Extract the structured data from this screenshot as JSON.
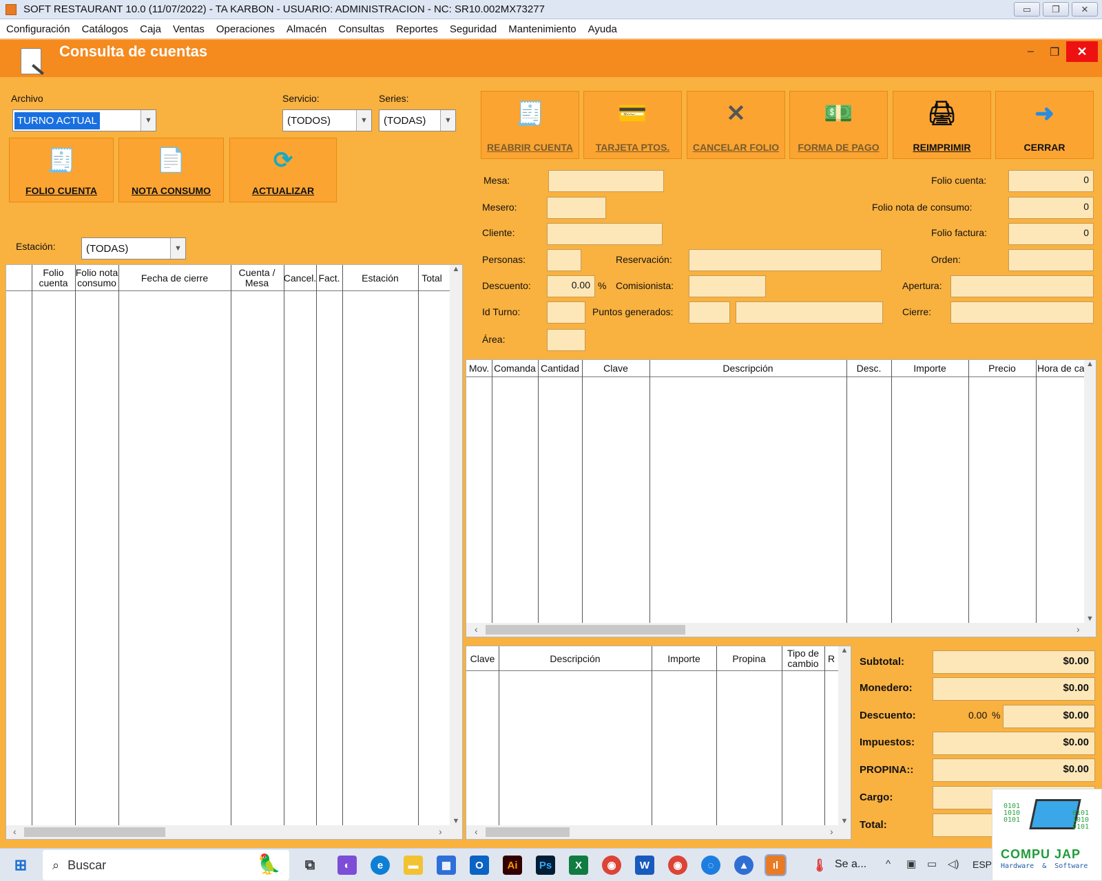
{
  "window": {
    "title": "SOFT RESTAURANT  10.0 (11/07/2022)  -  TA KARBON  -  USUARIO: ADMINISTRACION    -   NC: SR10.002MX73277"
  },
  "menu": [
    "Configuración",
    "Catálogos",
    "Caja",
    "Ventas",
    "Operaciones",
    "Almacén",
    "Consultas",
    "Reportes",
    "Seguridad",
    "Mantenimiento",
    "Ayuda"
  ],
  "header": {
    "title": "Consulta de cuentas"
  },
  "filters": {
    "archivo_label": "Archivo",
    "archivo_value": "TURNO ACTUAL",
    "servicio_label": "Servicio:",
    "servicio_value": "(TODOS)",
    "series_label": "Series:",
    "series_value": "(TODAS)",
    "estacion_label": "Estación:",
    "estacion_value": "(TODAS)"
  },
  "left_buttons": [
    "FOLIO CUENTA",
    "NOTA CONSUMO",
    "ACTUALIZAR"
  ],
  "actions": [
    "REABRIR CUENTA",
    "TARJETA PTOS.",
    "CANCELAR FOLIO",
    "FORMA DE PAGO",
    "REIMPRIMIR",
    "CERRAR"
  ],
  "form": {
    "mesa": "Mesa:",
    "mesero": "Mesero:",
    "cliente": "Cliente:",
    "personas": "Personas:",
    "reservacion": "Reservación:",
    "descuento": "Descuento:",
    "descuento_value": "0.00",
    "pct": "%",
    "comisionista": "Comisionista:",
    "id_turno": "Id Turno:",
    "puntos": "Puntos generados:",
    "area": "Área:",
    "folio_cuenta": "Folio cuenta:",
    "folio_cuenta_value": "0",
    "folio_nota": "Folio nota de consumo:",
    "folio_nota_value": "0",
    "folio_factura": "Folio factura:",
    "folio_factura_value": "0",
    "orden": "Orden:",
    "apertura": "Apertura:",
    "cierre": "Cierre:"
  },
  "accounts_grid": {
    "headers": [
      "Folio cuenta",
      "Folio nota consumo",
      "Fecha de cierre",
      "Cuenta / Mesa",
      "Cancel.",
      "Fact.",
      "Estación",
      "Total"
    ]
  },
  "items_grid": {
    "headers": [
      "Mov.",
      "Comanda",
      "Cantidad",
      "Clave",
      "Descripción",
      "Desc.",
      "Importe",
      "Precio",
      "Hora de ca"
    ]
  },
  "payments_grid": {
    "headers": [
      "Clave",
      "Descripción",
      "Importe",
      "Propina",
      "Tipo de cambio",
      "R"
    ]
  },
  "summary": {
    "subtotal": "Subtotal:",
    "subtotal_value": "$0.00",
    "monedero": "Monedero:",
    "monedero_value": "$0.00",
    "descuento": "Descuento:",
    "descuento_pct": "0.00",
    "pct": "%",
    "descuento_value": "$0.00",
    "impuestos": "Impuestos:",
    "impuestos_value": "$0.00",
    "propina": "PROPINA::",
    "propina_value": "$0.00",
    "cargo": "Cargo:",
    "total": "Total:"
  },
  "taskbar": {
    "search": "Buscar",
    "weather": "Se a...",
    "lang": "ESP"
  },
  "logo": {
    "name": "COMPU JAP",
    "tagline": "Hardware  &  Software"
  },
  "colors": {
    "background": "#f9b13f",
    "header": "#f58a1f",
    "field": "#fde7b8",
    "close": "#e11111"
  }
}
